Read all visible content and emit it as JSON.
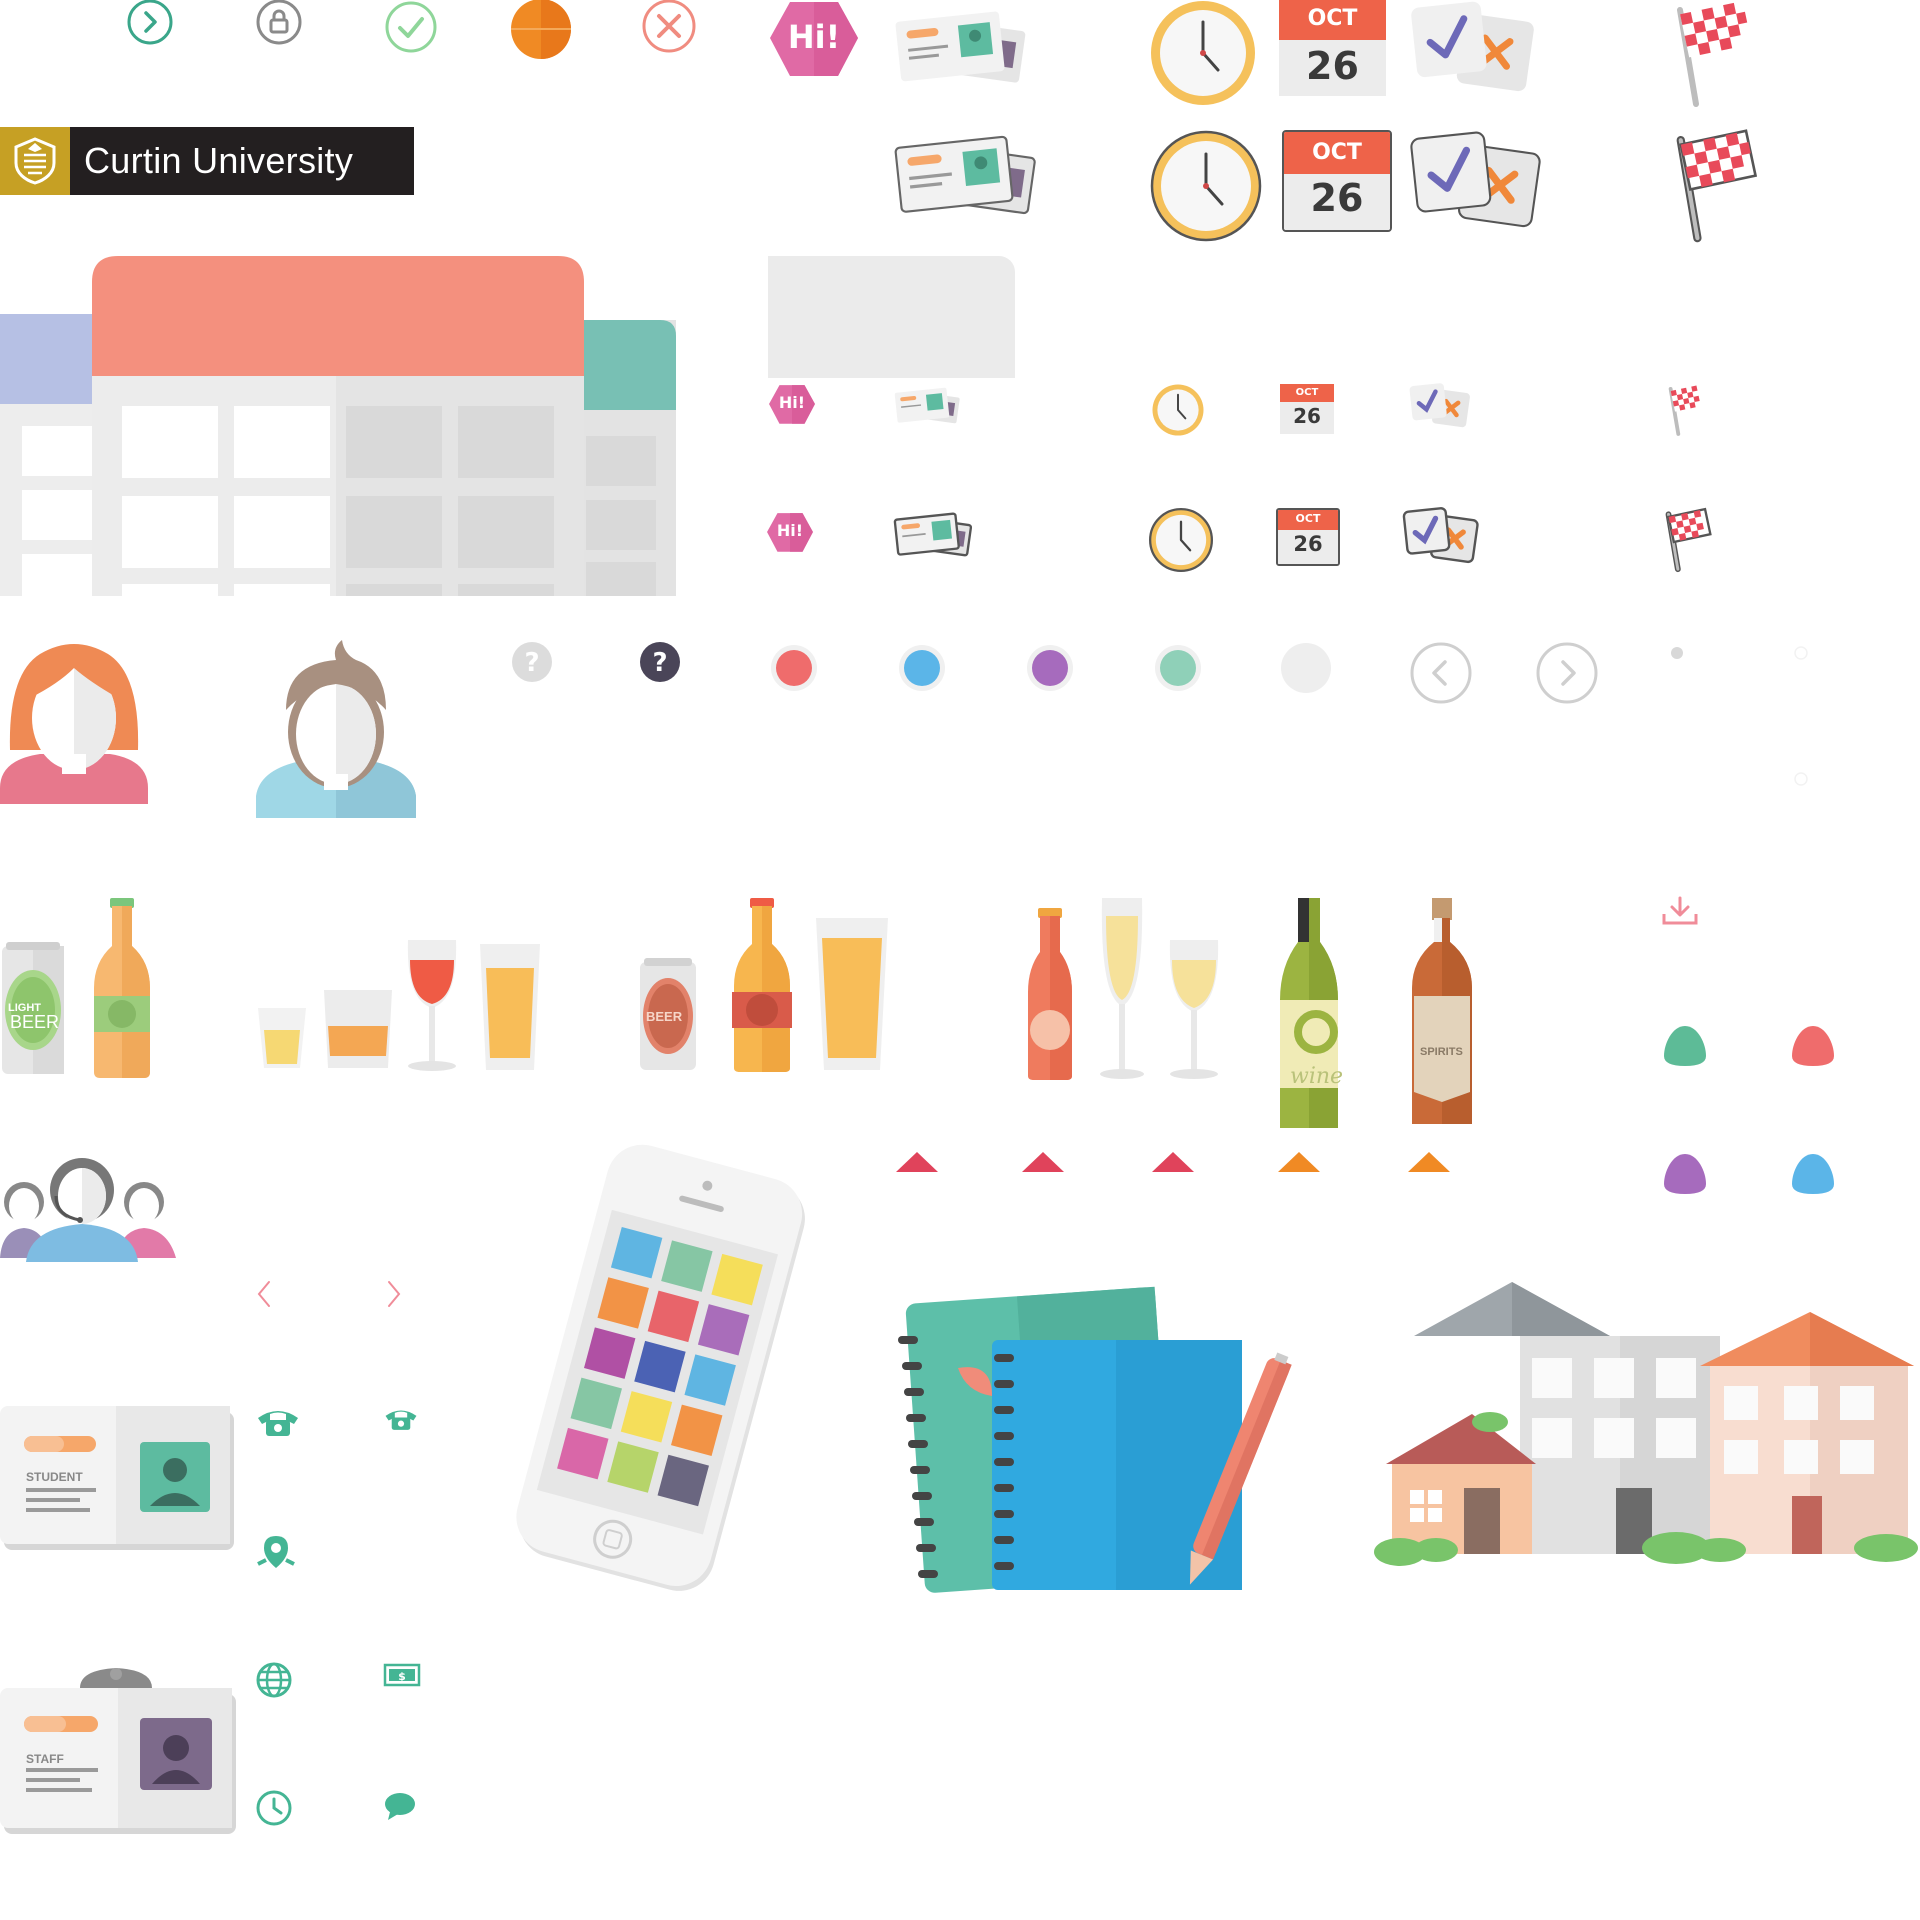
{
  "brand": {
    "university_name": "Curtin University"
  },
  "badges": {
    "hi_large": "Hi!",
    "hi_small_1": "Hi!",
    "hi_small_2": "Hi!"
  },
  "calendar": {
    "month_large_1": "OCT",
    "day_large_1": "26",
    "month_large_2": "OCT",
    "day_large_2": "26",
    "month_small_1": "OCT",
    "day_small_1": "26",
    "month_small_2": "OCT",
    "day_small_2": "26"
  },
  "drinks": {
    "light_beer_line1": "LIGHT",
    "light_beer_line2": "BEER",
    "beer_can": "BEER",
    "wine_label": "wine",
    "spirits_label": "SPIRITS"
  },
  "id_cards": {
    "student_label": "STUDENT",
    "staff_label": "STAFF"
  },
  "colors": {
    "teal": "#5dc0a6",
    "salmon": "#f4907e",
    "orange": "#f08a24",
    "pink": "#e06aa5",
    "red": "#ef6c6c",
    "blue": "#5bb5e8",
    "purple": "#a66bbd",
    "mint": "#8fd0b8",
    "crimson": "#e0435b",
    "gold": "#c6a024"
  },
  "icons": [
    "chevron-right-circle-icon",
    "lock-circle-icon",
    "check-circle-icon",
    "orange-ball-icon",
    "close-circle-icon",
    "hi-badge-icon",
    "id-cards-icon",
    "clock-icon",
    "calendar-icon",
    "check-x-cards-icon",
    "checkered-flag-icon",
    "help-icon",
    "arrow-left-circle-icon",
    "arrow-right-circle-icon",
    "download-icon",
    "phone-icon",
    "location-pin-icon",
    "globe-icon",
    "money-icon",
    "clock-outline-icon",
    "chat-bubble-icon",
    "smartphone-icon",
    "notebook-icon",
    "houses-icon"
  ]
}
